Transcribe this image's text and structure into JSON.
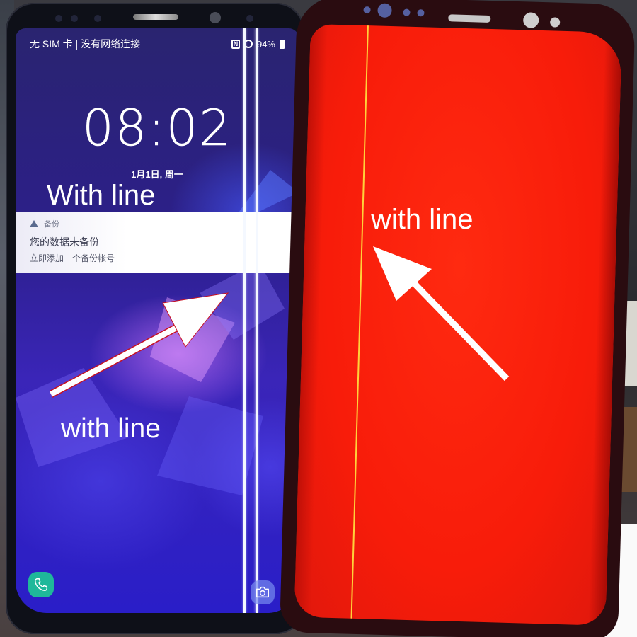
{
  "left_phone": {
    "status_bar": {
      "carrier_text": "无 SIM 卡 | 没有网络连接",
      "nfc_label": "N",
      "battery_percent": "94%"
    },
    "lock_screen": {
      "time": "08:02",
      "date": "1月1日, 周一"
    },
    "notification": {
      "app_name": "备份",
      "title": "您的数据未备份",
      "text": "立即添加一个备份帐号"
    },
    "shortcuts": [
      {
        "name": "phone",
        "icon": "phone-icon",
        "color": "#1fb89a"
      },
      {
        "name": "camera",
        "icon": "camera-icon"
      }
    ],
    "annotations": {
      "top_label": "With line",
      "bottom_label": "with line"
    }
  },
  "right_phone": {
    "screen_color": "#f81c0a",
    "defect_line_color": "#ffd23a",
    "annotations": {
      "label": "with line"
    }
  }
}
